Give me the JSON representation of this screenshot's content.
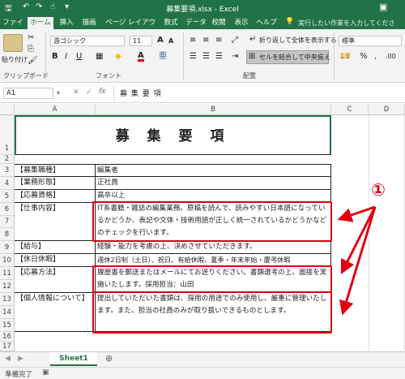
{
  "window": {
    "title": "募集要項.xlsx  -  Excel"
  },
  "tabs": [
    "ファイル",
    "ホーム",
    "挿入",
    "描画",
    "ページ レイアウト",
    "数式",
    "データ",
    "校閲",
    "表示",
    "ヘルプ"
  ],
  "active_tab": "ホーム",
  "tell_me": "実行したい作業を入力してくださ",
  "ribbon": {
    "paste_label": "貼り付け",
    "clipboard_group": "クリップボード",
    "font_group": "フォント",
    "alignment_group": "配置",
    "font_name": "游ゴシック",
    "font_size": "11",
    "wrap_text": "折り返して全体を表示する",
    "merge_center": "セルを結合して中央揃え",
    "number_format": "標準",
    "bold": "B",
    "italic": "I",
    "underline": "U",
    "grow_font": "A",
    "shrink_font": "A",
    "font_color_glyph": "A"
  },
  "formula_bar": {
    "name_box": "A1",
    "fx": "fx",
    "content": "募 集 要 項"
  },
  "columns": [
    "A",
    "B",
    "C",
    "D"
  ],
  "rows": [
    {
      "num": "1",
      "a": "",
      "b": ""
    },
    {
      "num": "2",
      "a": "",
      "b": ""
    },
    {
      "num": "3",
      "a": "【募集職種】",
      "b": "編集者"
    },
    {
      "num": "4",
      "a": "【業務形態】",
      "b": "正社員"
    },
    {
      "num": "5",
      "a": "【応募資格】",
      "b": "高卒以上"
    },
    {
      "num": "6",
      "a": "【仕事内容】",
      "b": "IT系書籍・雑誌の編集業務。原稿を読んで、読みやすい日本語になっているかどうか、表記や文体・技術用語が正しく統一されているかどうかなどのチェックを行います。"
    },
    {
      "num": "7",
      "a": "",
      "b": ""
    },
    {
      "num": "8",
      "a": "",
      "b": ""
    },
    {
      "num": "9",
      "a": "【給与】",
      "b": "経験・能力を考慮の上、決めさせていただきます。"
    },
    {
      "num": "10",
      "a": "【休日休暇】",
      "b": "週休2日制（土日）、祝日、有給休暇、夏季・年末年始・慶弔休暇"
    },
    {
      "num": "11",
      "a": "【応募方法】",
      "b": "履歴書を郵送またはメールにてお送りください。書類選考の上、面接を実施いたします。採用担当：山田"
    },
    {
      "num": "12",
      "a": "",
      "b": ""
    },
    {
      "num": "13",
      "a": "【個人情報について】",
      "b": "提出していただいた書類は、採用の用途でのみ使用し、厳重に管理いたします。また、担当の社員のみが取り扱いできるものとします。"
    },
    {
      "num": "14",
      "a": "",
      "b": ""
    },
    {
      "num": "15",
      "a": "",
      "b": ""
    },
    {
      "num": "16",
      "a": "",
      "b": ""
    },
    {
      "num": "17",
      "a": "",
      "b": ""
    }
  ],
  "title_cell": "募 集 要 項",
  "annotation": {
    "marker": "①",
    "color": "#e00012"
  },
  "sheet_tab": "Sheet1",
  "status": "準備完了",
  "colors": {
    "excel_green": "#217346",
    "highlight_red": "#e00012"
  }
}
